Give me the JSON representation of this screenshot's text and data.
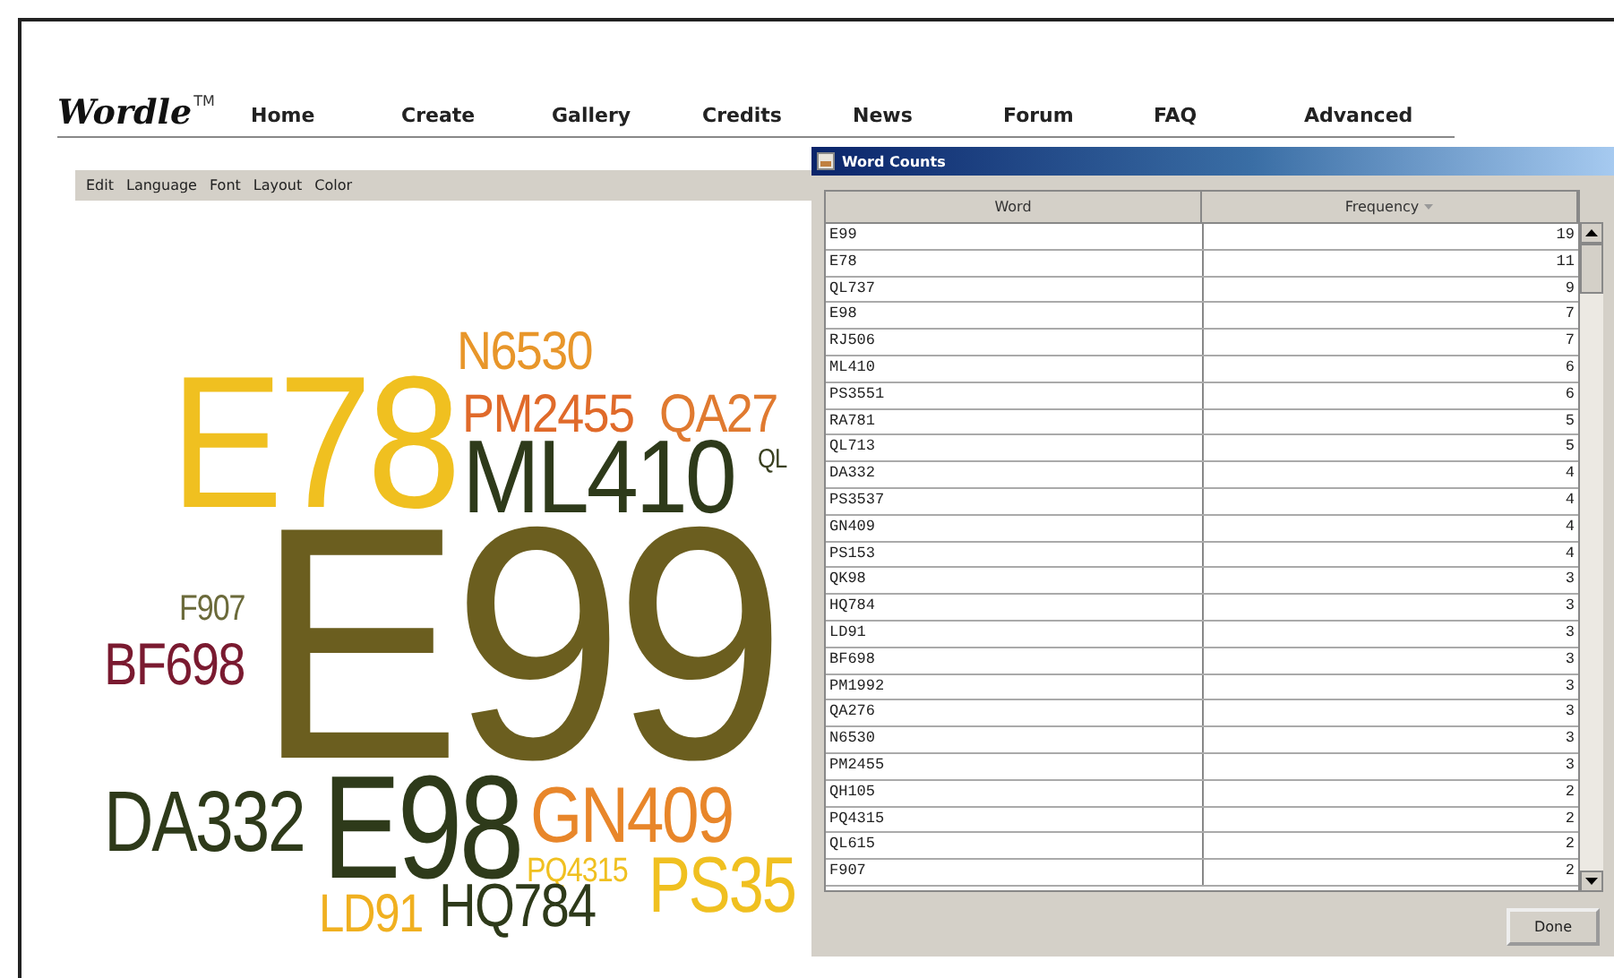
{
  "site": {
    "logo": "Wordle",
    "trademark": "TM",
    "nav": [
      "Home",
      "Create",
      "Gallery",
      "Credits",
      "News",
      "Forum",
      "FAQ",
      "Advanced"
    ]
  },
  "applet": {
    "menu": [
      "Edit",
      "Language",
      "Font",
      "Layout",
      "Color"
    ],
    "cloud": [
      {
        "text": "N6530",
        "color": "#e8962a"
      },
      {
        "text": "E78",
        "color": "#f0c020"
      },
      {
        "text": "PM2455",
        "color": "#e06a2a"
      },
      {
        "text": "QA27",
        "color": "#e07a30"
      },
      {
        "text": "ML410",
        "color": "#2e3a1a"
      },
      {
        "text": "QL",
        "color": "#3a4020"
      },
      {
        "text": "F907",
        "color": "#6b6a3a"
      },
      {
        "text": "BF698",
        "color": "#7a1a30"
      },
      {
        "text": "E99",
        "color": "#6b5e1f"
      },
      {
        "text": "DA332",
        "color": "#2e3a1a"
      },
      {
        "text": "E98",
        "color": "#2e3a1a"
      },
      {
        "text": "GN409",
        "color": "#e8862a"
      },
      {
        "text": "PQ4315",
        "color": "#f0c020"
      },
      {
        "text": "PS35",
        "color": "#f0c020"
      },
      {
        "text": "LD91",
        "color": "#f0b020"
      },
      {
        "text": "HQ784",
        "color": "#2e3a1a"
      }
    ]
  },
  "dialog": {
    "title": "Word Counts",
    "columns": [
      "Word",
      "Frequency"
    ],
    "rows": [
      [
        "E99",
        "19"
      ],
      [
        "E78",
        "11"
      ],
      [
        "QL737",
        "9"
      ],
      [
        "E98",
        "7"
      ],
      [
        "RJ506",
        "7"
      ],
      [
        "ML410",
        "6"
      ],
      [
        "PS3551",
        "6"
      ],
      [
        "RA781",
        "5"
      ],
      [
        "QL713",
        "5"
      ],
      [
        "DA332",
        "4"
      ],
      [
        "PS3537",
        "4"
      ],
      [
        "GN409",
        "4"
      ],
      [
        "PS153",
        "4"
      ],
      [
        "QK98",
        "3"
      ],
      [
        "HQ784",
        "3"
      ],
      [
        "LD91",
        "3"
      ],
      [
        "BF698",
        "3"
      ],
      [
        "PM1992",
        "3"
      ],
      [
        "QA276",
        "3"
      ],
      [
        "N6530",
        "3"
      ],
      [
        "PM2455",
        "3"
      ],
      [
        "QH105",
        "2"
      ],
      [
        "PQ4315",
        "2"
      ],
      [
        "QL615",
        "2"
      ],
      [
        "F907",
        "2"
      ]
    ],
    "button": "Done"
  }
}
